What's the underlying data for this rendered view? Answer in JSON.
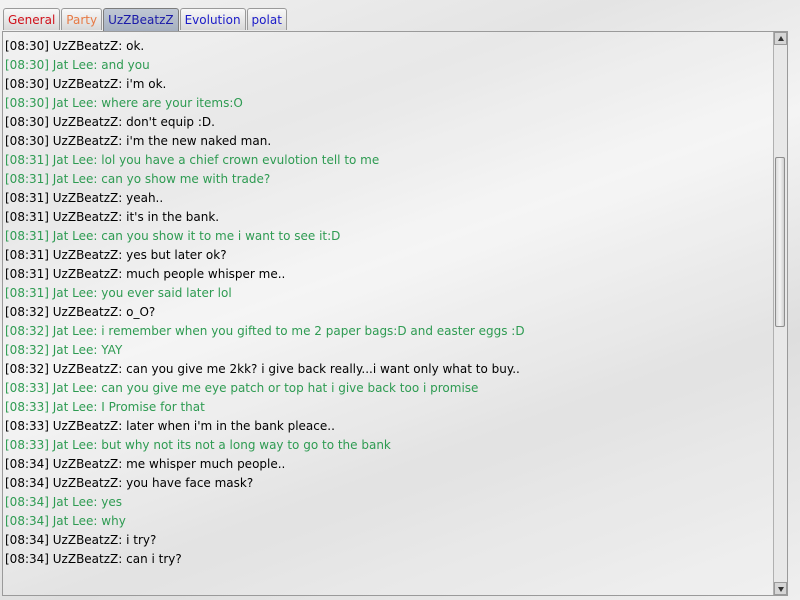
{
  "tabs": [
    {
      "label": "General",
      "color": "#d0101a"
    },
    {
      "label": "Party",
      "color": "#e77a45"
    },
    {
      "label": "UzZBeatzZ",
      "color": "#1a1aa8"
    },
    {
      "label": "Evolution",
      "color": "#1a1ac8"
    },
    {
      "label": "polat",
      "color": "#1a1ac8"
    }
  ],
  "active_tab": "UzZBeatzZ",
  "colors": {
    "own_message": "#000000",
    "other_message": "#2e9b52"
  },
  "messages": [
    {
      "text": "[08:30] UzZBeatzZ: ok.",
      "sender": "self"
    },
    {
      "text": "[08:30] Jat Lee: and you",
      "sender": "other"
    },
    {
      "text": "[08:30] UzZBeatzZ: i'm ok.",
      "sender": "self"
    },
    {
      "text": "[08:30] Jat Lee: where are your items:O",
      "sender": "other"
    },
    {
      "text": "[08:30] UzZBeatzZ: don't equip :D.",
      "sender": "self"
    },
    {
      "text": "[08:30] UzZBeatzZ: i'm the new naked man.",
      "sender": "self"
    },
    {
      "text": "[08:31] Jat Lee: lol you have a chief crown evulotion tell to me",
      "sender": "other"
    },
    {
      "text": "[08:31] Jat Lee: can yo show me with trade?",
      "sender": "other"
    },
    {
      "text": "[08:31] UzZBeatzZ: yeah..",
      "sender": "self"
    },
    {
      "text": "[08:31] UzZBeatzZ: it's in the bank.",
      "sender": "self"
    },
    {
      "text": "[08:31] Jat Lee: can you show it to me i want to see it:D",
      "sender": "other"
    },
    {
      "text": "[08:31] UzZBeatzZ: yes but later ok?",
      "sender": "self"
    },
    {
      "text": "[08:31] UzZBeatzZ: much people whisper me..",
      "sender": "self"
    },
    {
      "text": "[08:31] Jat Lee: you ever said later lol",
      "sender": "other"
    },
    {
      "text": "[08:32] UzZBeatzZ: o_O?",
      "sender": "self"
    },
    {
      "text": "[08:32] Jat Lee: i remember when you gifted to me 2 paper bags:D and easter eggs :D",
      "sender": "other"
    },
    {
      "text": "[08:32] Jat Lee: YAY",
      "sender": "other"
    },
    {
      "text": "[08:32] UzZBeatzZ: can you give me 2kk? i give back really...i want only what to buy..",
      "sender": "self"
    },
    {
      "text": "[08:33] Jat Lee: can you give me eye patch or top hat i give back too i promise",
      "sender": "other"
    },
    {
      "text": "[08:33] Jat Lee: I Promise for that",
      "sender": "other"
    },
    {
      "text": "[08:33] UzZBeatzZ: later when i'm in the bank pleace..",
      "sender": "self"
    },
    {
      "text": "[08:33] Jat Lee: but why not its not a long way to go to the bank",
      "sender": "other"
    },
    {
      "text": "[08:34] UzZBeatzZ: me whisper much people..",
      "sender": "self"
    },
    {
      "text": "[08:34] UzZBeatzZ: you have face mask?",
      "sender": "self"
    },
    {
      "text": "[08:34] Jat Lee: yes",
      "sender": "other"
    },
    {
      "text": "[08:34] Jat Lee: why",
      "sender": "other"
    },
    {
      "text": "[08:34] UzZBeatzZ: i try?",
      "sender": "self"
    },
    {
      "text": "[08:34] UzZBeatzZ: can i try?",
      "sender": "self"
    }
  ],
  "scrollbar": {
    "position_fraction": 0.85
  }
}
